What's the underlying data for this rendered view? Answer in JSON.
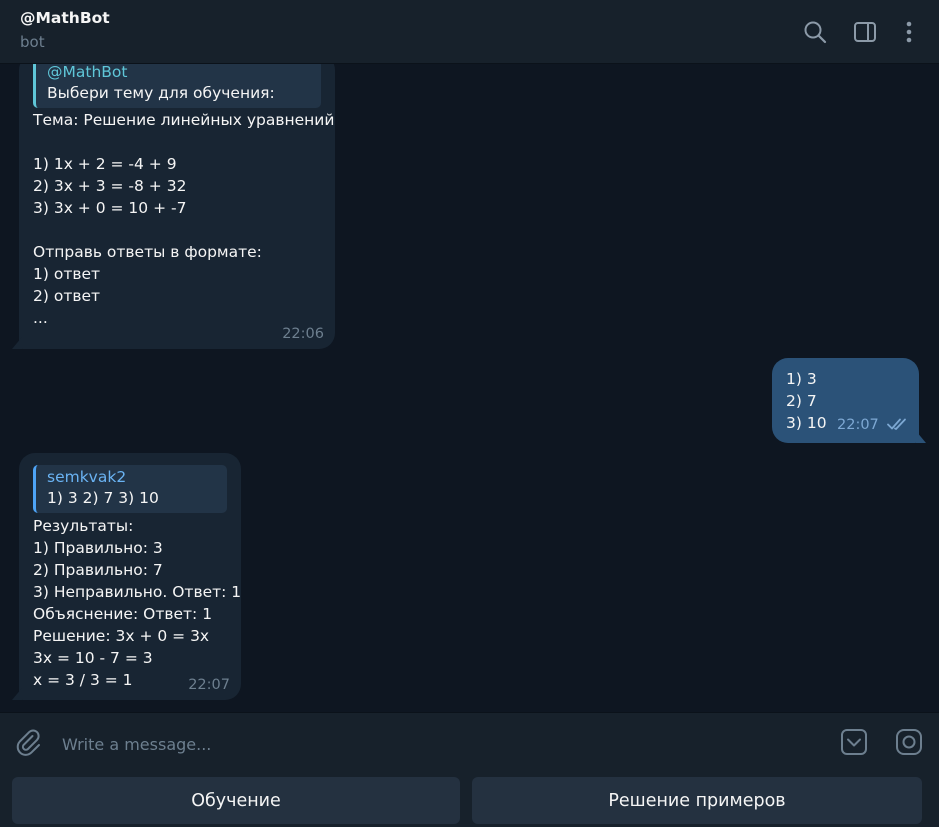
{
  "header": {
    "title": "@MathBot",
    "subtitle": "bot"
  },
  "messages": {
    "m1": {
      "reply_name": "@MathBot",
      "reply_text": "Выбери тему для обучения:",
      "text": "Тема: Решение линейных уравнений\n\n1) 1x + 2 = -4 + 9\n2) 3x + 3 = -8 + 32\n3) 3x + 0 = 10 + -7\n\nОтправь ответы в формате:\n1) ответ\n2) ответ\n...",
      "time": "22:06"
    },
    "m2": {
      "text": "1) 3\n2) 7\n3) 10",
      "time": "22:07"
    },
    "m3": {
      "reply_name": "semkvak2",
      "reply_text": "1) 3  2) 7 3) 10",
      "text": "Результаты:\n1) Правильно: 3\n2) Правильно: 7\n3) Неправильно. Ответ: 1\nОбъяснение: Ответ: 1\nРешение: 3x + 0 = 3x\n3x = 10 - 7 = 3\nx = 3 / 3 = 1",
      "time": "22:07"
    }
  },
  "input": {
    "placeholder": "Write a message..."
  },
  "keyboard": {
    "btn1": "Обучение",
    "btn2": "Решение примеров"
  },
  "icons": {
    "search": "search-icon",
    "sidebar": "sidebar-toggle-icon",
    "menu": "more-vertical-icon",
    "attach": "paperclip-icon",
    "keyboard": "bot-keyboard-icon",
    "sticker": "sticker-icon",
    "read": "double-check-icon"
  },
  "colors": {
    "background": "#0e1621",
    "incoming": "#182533",
    "outgoing": "#2b5278",
    "accent": "#5fc6d8",
    "panel": "#17212b"
  }
}
